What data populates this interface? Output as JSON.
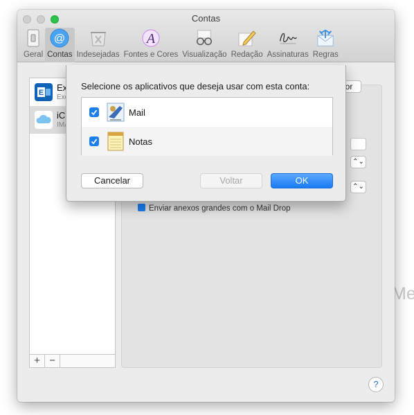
{
  "window": {
    "title": "Contas"
  },
  "toolbar": {
    "items": [
      {
        "label": "Geral"
      },
      {
        "label": "Contas"
      },
      {
        "label": "Indesejadas"
      },
      {
        "label": "Fontes e Cores"
      },
      {
        "label": "Visualização"
      },
      {
        "label": "Redação"
      },
      {
        "label": "Assinaturas"
      },
      {
        "label": "Regras"
      }
    ]
  },
  "sidebar": {
    "accounts": [
      {
        "name": "Ex",
        "subtitle": "Exc"
      },
      {
        "name": "iC",
        "subtitle": "IMA"
      }
    ],
    "add_label": "+",
    "remove_label": "−"
  },
  "panel": {
    "button_fragment": "or",
    "mail_drop_label": "Enviar anexos grandes com o Mail Drop",
    "popup_arrows": "⌃⌄"
  },
  "background_fragment": "Me",
  "help_label": "?",
  "sheet": {
    "prompt": "Selecione os aplicativos que deseja usar com esta conta:",
    "apps": [
      {
        "name": "Mail",
        "checked": true
      },
      {
        "name": "Notas",
        "checked": true
      }
    ],
    "buttons": {
      "cancel": "Cancelar",
      "back": "Voltar",
      "ok": "OK"
    }
  },
  "colors": {
    "accent": "#1b7ff0",
    "ok_button": "#1a7bf2"
  }
}
